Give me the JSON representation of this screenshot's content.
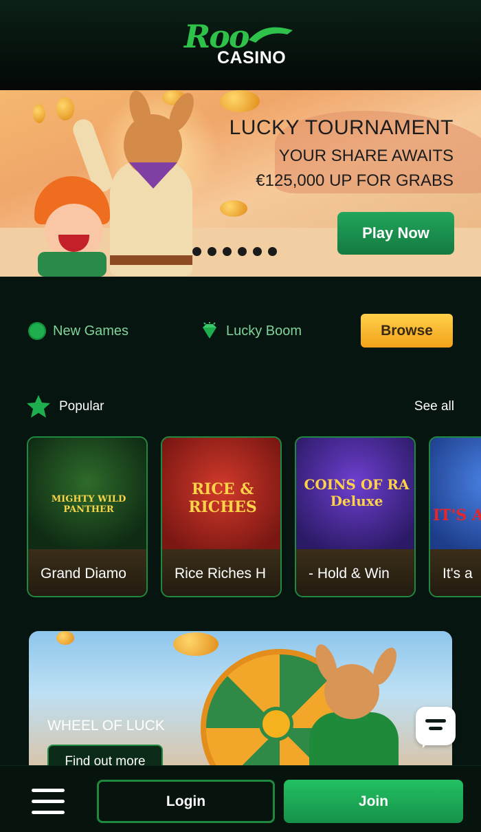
{
  "header": {
    "logo_script": "Roo",
    "logo_word": "CASINO",
    "brand_color": "#2fc24a"
  },
  "banner": {
    "title": "LUCKY TOURNAMENT",
    "subtitle": "YOUR SHARE AWAITS",
    "prize": "€125,000 UP FOR GRABS",
    "cta_label": "Play Now",
    "slide_count": 6
  },
  "quick_nav": {
    "items": [
      {
        "label": "New Games",
        "icon": "badge-icon"
      },
      {
        "label": "Lucky Boom",
        "icon": "gem-icon"
      }
    ],
    "browse_label": "Browse"
  },
  "popular": {
    "title": "Popular",
    "see_all": "See all",
    "games": [
      {
        "caption": "Grand Diamo",
        "thumb_text": "MIGHTY WILD PANTHER"
      },
      {
        "caption": "Rice Riches H",
        "thumb_text": "RICE & RICHES"
      },
      {
        "caption": "- Hold & Win",
        "thumb_text": "COINS OF RA Deluxe"
      },
      {
        "caption": "It's a",
        "thumb_text": "IT'S A"
      }
    ]
  },
  "promo": {
    "title": "WHEEL OF LUCK",
    "cta_label": "Find out more"
  },
  "bottom_bar": {
    "login_label": "Login",
    "join_label": "Join"
  },
  "colors": {
    "background": "#071510",
    "accent_green": "#1f8a3f",
    "browse_yellow": "#f2a21a"
  }
}
